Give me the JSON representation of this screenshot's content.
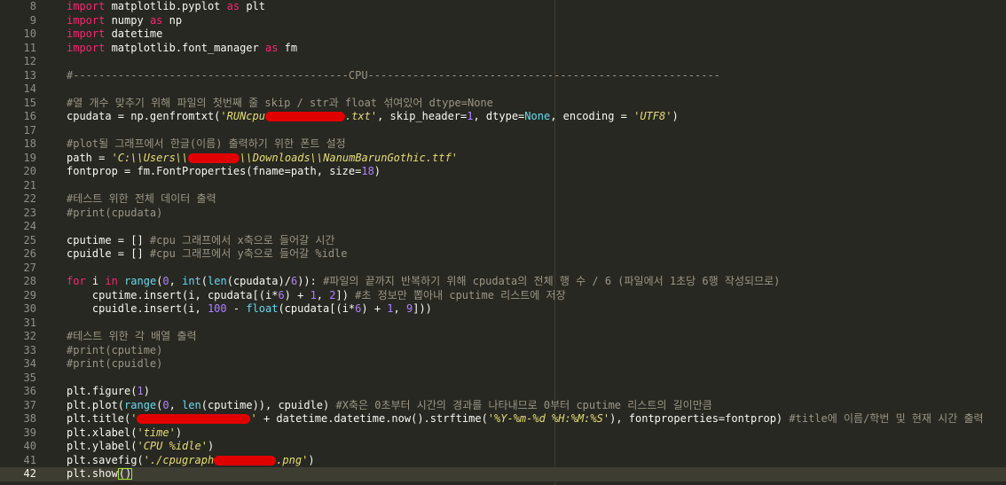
{
  "colors": {
    "background": "#272822",
    "text": "#f8f8f2",
    "keyword": "#f92672",
    "builtin": "#66d9ef",
    "number": "#ae81ff",
    "string": "#e6db74",
    "comment": "#9a9686",
    "redaction": "#e00000",
    "bracket_match": "#a6e22e"
  },
  "editor": {
    "active_line": 42,
    "lines": [
      {
        "n": 8,
        "t": [
          [
            "kw",
            "import"
          ],
          [
            "p",
            " matplotlib.pyplot "
          ],
          [
            "kw",
            "as"
          ],
          [
            "p",
            " plt"
          ]
        ]
      },
      {
        "n": 9,
        "t": [
          [
            "kw",
            "import"
          ],
          [
            "p",
            " numpy "
          ],
          [
            "kw",
            "as"
          ],
          [
            "p",
            " np"
          ]
        ]
      },
      {
        "n": 10,
        "t": [
          [
            "kw",
            "import"
          ],
          [
            "p",
            " datetime"
          ]
        ]
      },
      {
        "n": 11,
        "t": [
          [
            "kw",
            "import"
          ],
          [
            "p",
            " matplotlib.font_manager "
          ],
          [
            "kw",
            "as"
          ],
          [
            "p",
            " fm"
          ]
        ]
      },
      {
        "n": 12,
        "t": []
      },
      {
        "n": 13,
        "t": [
          [
            "cm",
            "#-------------------------------------------CPU-------------------------------------------------------"
          ]
        ]
      },
      {
        "n": 14,
        "t": []
      },
      {
        "n": 15,
        "t": [
          [
            "cm",
            "#열 개수 맞추기 위해 파일의 첫번째 줄 skip / str과 float 섞여있어 dtype=None"
          ]
        ]
      },
      {
        "n": 16,
        "t": [
          [
            "p",
            "cpudata = np.genfromtxt("
          ],
          [
            "str",
            "'RUNcpu"
          ],
          [
            "redact",
            ""
          ],
          [
            "str",
            ".txt'"
          ],
          [
            "p",
            ", skip_header="
          ],
          [
            "num",
            "1"
          ],
          [
            "p",
            ", dtype="
          ],
          [
            "fn",
            "None"
          ],
          [
            "p",
            ", encoding = "
          ],
          [
            "str",
            "'UTF8'"
          ],
          [
            "p",
            ")"
          ]
        ]
      },
      {
        "n": 17,
        "t": []
      },
      {
        "n": 18,
        "t": [
          [
            "cm",
            "#plot될 그래프에서 한글(이름) 출력하기 위한 폰트 설정"
          ]
        ]
      },
      {
        "n": 19,
        "t": [
          [
            "p",
            "path = "
          ],
          [
            "str",
            "'C:\\\\Users\\\\"
          ],
          [
            "redact",
            ""
          ],
          [
            "str",
            "\\\\Downloads\\\\NanumBarunGothic.ttf'"
          ]
        ]
      },
      {
        "n": 20,
        "t": [
          [
            "p",
            "fontprop = fm.FontProperties(fname=path, size="
          ],
          [
            "num",
            "18"
          ],
          [
            "p",
            ")"
          ]
        ]
      },
      {
        "n": 21,
        "t": []
      },
      {
        "n": 22,
        "t": [
          [
            "cm",
            "#테스트 위한 전체 데이터 출력"
          ]
        ]
      },
      {
        "n": 23,
        "t": [
          [
            "cm",
            "#print(cpudata)"
          ]
        ]
      },
      {
        "n": 24,
        "t": []
      },
      {
        "n": 25,
        "t": [
          [
            "p",
            "cputime = [] "
          ],
          [
            "cm",
            "#cpu 그래프에서 x축으로 들어갈 시간"
          ]
        ]
      },
      {
        "n": 26,
        "t": [
          [
            "p",
            "cpuidle = [] "
          ],
          [
            "cm",
            "#cpu 그래프에서 y축으로 들어갈 %idle"
          ]
        ]
      },
      {
        "n": 27,
        "t": []
      },
      {
        "n": 28,
        "t": [
          [
            "kw",
            "for"
          ],
          [
            "p",
            " i "
          ],
          [
            "kw",
            "in"
          ],
          [
            "p",
            " "
          ],
          [
            "fn",
            "range"
          ],
          [
            "p",
            "("
          ],
          [
            "num",
            "0"
          ],
          [
            "p",
            ", "
          ],
          [
            "fn",
            "int"
          ],
          [
            "p",
            "("
          ],
          [
            "fn",
            "len"
          ],
          [
            "p",
            "(cpudata)/"
          ],
          [
            "num",
            "6"
          ],
          [
            "p",
            "))"
          ],
          [
            "p",
            ": "
          ],
          [
            "cm",
            "#파일의 끝까지 반복하기 위해 cpudata의 전체 행 수 / 6 (파일에서 1초당 6행 작성되므로)"
          ]
        ]
      },
      {
        "n": 29,
        "t": [
          [
            "p",
            "    cputime.insert(i, cpudata[(i*"
          ],
          [
            "num",
            "6"
          ],
          [
            "p",
            ") + "
          ],
          [
            "num",
            "1"
          ],
          [
            "p",
            ", "
          ],
          [
            "num",
            "2"
          ],
          [
            "p",
            "]) "
          ],
          [
            "cm",
            "#초 정보만 뽑아내 cputime 리스트에 저장"
          ]
        ]
      },
      {
        "n": 30,
        "t": [
          [
            "p",
            "    cpuidle.insert(i, "
          ],
          [
            "num",
            "100"
          ],
          [
            "p",
            " - "
          ],
          [
            "fn",
            "float"
          ],
          [
            "p",
            "(cpudata[(i*"
          ],
          [
            "num",
            "6"
          ],
          [
            "p",
            ") + "
          ],
          [
            "num",
            "1"
          ],
          [
            "p",
            ", "
          ],
          [
            "num",
            "9"
          ],
          [
            "p",
            "]))"
          ]
        ]
      },
      {
        "n": 31,
        "t": []
      },
      {
        "n": 32,
        "t": [
          [
            "cm",
            "#테스트 위한 각 배열 출력"
          ]
        ]
      },
      {
        "n": 33,
        "t": [
          [
            "cm",
            "#print(cputime)"
          ]
        ]
      },
      {
        "n": 34,
        "t": [
          [
            "cm",
            "#print(cpuidle)"
          ]
        ]
      },
      {
        "n": 35,
        "t": []
      },
      {
        "n": 36,
        "t": [
          [
            "p",
            "plt.figure("
          ],
          [
            "num",
            "1"
          ],
          [
            "p",
            ")"
          ]
        ]
      },
      {
        "n": 37,
        "t": [
          [
            "p",
            "plt.plot("
          ],
          [
            "fn",
            "range"
          ],
          [
            "p",
            "("
          ],
          [
            "num",
            "0"
          ],
          [
            "p",
            ", "
          ],
          [
            "fn",
            "len"
          ],
          [
            "p",
            "(cputime)), cpuidle) "
          ],
          [
            "cm",
            "#X축은 0초부터 시간의 경과를 나타내므로 0부터 cputime 리스트의 길이만큼"
          ]
        ]
      },
      {
        "n": 38,
        "t": [
          [
            "p",
            "plt.title("
          ],
          [
            "str",
            "'"
          ],
          [
            "redact",
            ""
          ],
          [
            "str",
            "'"
          ],
          [
            "p",
            " + datetime.datetime.now().strftime("
          ],
          [
            "str",
            "'%Y-%m-%d %H:%M:%S'"
          ],
          [
            "p",
            "), fontproperties=fontprop) "
          ],
          [
            "cm",
            "#title에 이름/학번 및 현재 시간 출력"
          ]
        ]
      },
      {
        "n": 39,
        "t": [
          [
            "p",
            "plt.xlabel("
          ],
          [
            "str",
            "'time'"
          ],
          [
            "p",
            ")"
          ]
        ]
      },
      {
        "n": 40,
        "t": [
          [
            "p",
            "plt.ylabel("
          ],
          [
            "str",
            "'CPU %idle'"
          ],
          [
            "p",
            ")"
          ]
        ]
      },
      {
        "n": 41,
        "t": [
          [
            "p",
            "plt.savefig("
          ],
          [
            "str",
            "'./cpugraph"
          ],
          [
            "redact",
            ""
          ],
          [
            "str",
            ".png'"
          ],
          [
            "p",
            ")"
          ]
        ]
      },
      {
        "n": 42,
        "t": [
          [
            "p",
            "plt.show"
          ],
          [
            "bm",
            "()"
          ]
        ]
      }
    ]
  }
}
